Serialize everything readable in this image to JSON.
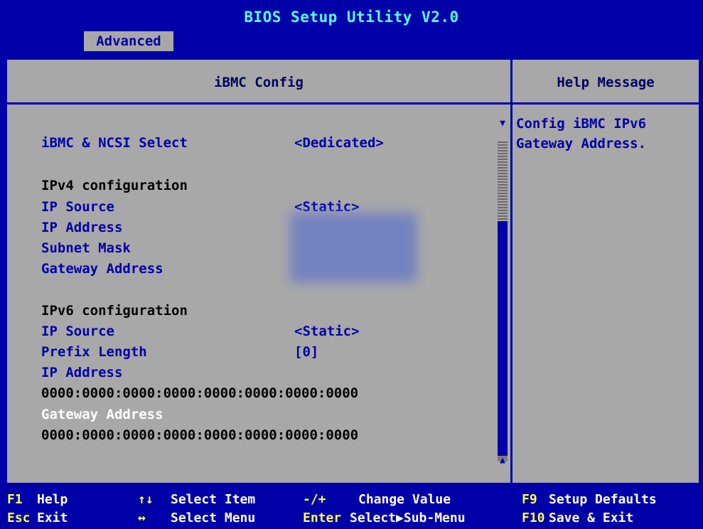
{
  "app": {
    "title": "BIOS Setup Utility V2.0"
  },
  "tabs": [
    {
      "label": "Advanced",
      "active": true
    }
  ],
  "main": {
    "header": "iBMC Config",
    "items": [
      {
        "label": "iBMC & NCSI Select",
        "value": "<Dedicated>"
      },
      {
        "label": "IPv4 configuration"
      },
      {
        "label": "IP Source",
        "value": "<Static>"
      },
      {
        "label": "IP Address"
      },
      {
        "label": "Subnet Mask"
      },
      {
        "label": "Gateway Address"
      },
      {
        "label": "IPv6 configuration"
      },
      {
        "label": "IP Source",
        "value": "<Static>"
      },
      {
        "label": "Prefix Length",
        "value": "[0]"
      },
      {
        "label": "IP Address"
      },
      {
        "label": "0000:0000:0000:0000:0000:0000:0000:0000"
      },
      {
        "label": "Gateway Address",
        "selected": true
      },
      {
        "label": "0000:0000:0000:0000:0000:0000:0000:0000"
      }
    ],
    "scroll_up_arrow": "▼",
    "scroll_down_arrow": "▲"
  },
  "help": {
    "header": "Help Message",
    "text": "Config iBMC IPv6\nGateway Address."
  },
  "footer": {
    "keys": [
      {
        "key": "F1",
        "desc": "Help"
      },
      {
        "key": "Esc",
        "desc": "Exit"
      },
      {
        "key": "↑↓",
        "desc": "Select Item"
      },
      {
        "key": "↔",
        "desc": "Select Menu"
      },
      {
        "key": "-/+",
        "desc": "Change Value"
      },
      {
        "key": "Enter",
        "desc": "Select▶Sub-Menu"
      },
      {
        "key": "F9",
        "desc": "Setup Defaults"
      },
      {
        "key": "F10",
        "desc": "Save & Exit"
      }
    ]
  },
  "colors": {
    "background": "#0000a8",
    "panel": "#a8a8a8",
    "title": "#55ffff",
    "key": "#ffff55",
    "selected": "#ffffff"
  }
}
